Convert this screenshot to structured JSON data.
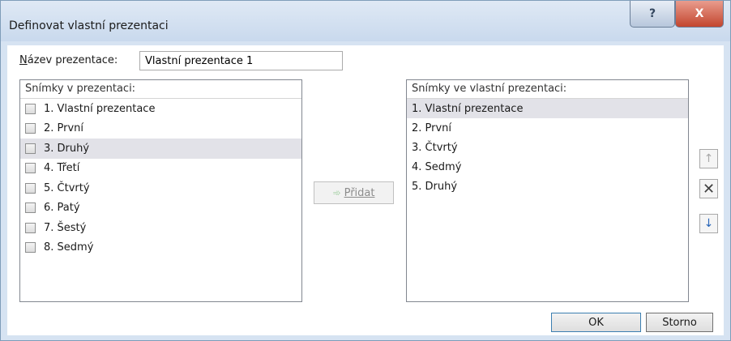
{
  "window": {
    "title": "Definovat vlastní prezentaci",
    "help_label": "?",
    "close_label": "X"
  },
  "name_field": {
    "label_prefix": "N",
    "label_rest": "ázev prezentace:",
    "value": "Vlastní prezentace 1"
  },
  "left_list": {
    "header": "Snímky v prezentaci:",
    "items": [
      {
        "label": "1. Vlastní prezentace",
        "selected": false
      },
      {
        "label": "2. První",
        "selected": false
      },
      {
        "label": "3. Druhý",
        "selected": true
      },
      {
        "label": "4. Třetí",
        "selected": false
      },
      {
        "label": "5. Čtvrtý",
        "selected": false
      },
      {
        "label": "6. Patý",
        "selected": false
      },
      {
        "label": "7. Šestý",
        "selected": false
      },
      {
        "label": "8. Sedmý",
        "selected": false
      }
    ]
  },
  "add_button": {
    "arrow": "➾",
    "label": "Přidat"
  },
  "right_list": {
    "header": "Snímky ve vlastní prezentaci:",
    "items": [
      {
        "label": "1. Vlastní prezentace",
        "selected": true
      },
      {
        "label": "2. První",
        "selected": false
      },
      {
        "label": "3. Čtvrtý",
        "selected": false
      },
      {
        "label": "4. Sedmý",
        "selected": false
      },
      {
        "label": "5. Druhý",
        "selected": false
      }
    ]
  },
  "side_buttons": {
    "up_icon": "arrow-up-icon",
    "delete_icon": "close-icon",
    "down_icon": "arrow-down-icon"
  },
  "footer": {
    "ok_label": "OK",
    "cancel_label": "Storno"
  }
}
